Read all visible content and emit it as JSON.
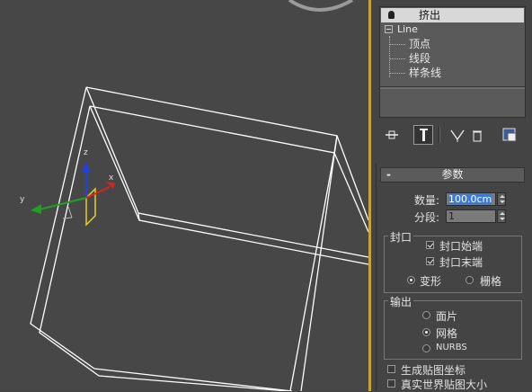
{
  "modifier_stack": {
    "items": [
      {
        "label": "挤出",
        "selected": true,
        "icon": "lightbulb-icon"
      },
      {
        "label": "Line",
        "expanded": true
      },
      {
        "label": "顶点"
      },
      {
        "label": "线段"
      },
      {
        "label": "样条线"
      }
    ]
  },
  "toolbar": {
    "pin_icon": "pin-stack-icon",
    "show_end_result_icon": "show-end-result-icon",
    "make_unique_icon": "make-unique-icon",
    "remove_modifier_icon": "remove-modifier-icon",
    "configure_icon": "configure-modifier-sets-icon"
  },
  "parameters": {
    "title": "参数",
    "collapse_symbol": "-",
    "amount": {
      "label": "数量:",
      "value": "100.0cm"
    },
    "segments": {
      "label": "分段:",
      "value": "1"
    },
    "capping": {
      "title": "封口",
      "cap_start": {
        "label": "封口始端",
        "checked": true
      },
      "cap_end": {
        "label": "封口末端",
        "checked": true
      },
      "morph": {
        "label": "变形",
        "selected": true
      },
      "grid": {
        "label": "栅格",
        "selected": false
      }
    },
    "output": {
      "title": "输出",
      "patch": {
        "label": "面片",
        "selected": false
      },
      "mesh": {
        "label": "网格",
        "selected": true
      },
      "nurbs": {
        "label": "NURBS",
        "selected": false
      }
    },
    "generate_mapping": {
      "label": "生成贴图坐标",
      "checked": false
    },
    "real_world_map_size": {
      "label": "真实世界贴图大小",
      "checked": false
    }
  },
  "viewport": {
    "axis_labels": {
      "x": "x",
      "y": "y",
      "z": "z"
    },
    "colors": {
      "x": "#e02020",
      "y": "#20a020",
      "z": "#2040e0",
      "gizmo_plane": "#e8d020",
      "wire": "#ffffff",
      "background": "#474747",
      "active_border": "#c9a23a"
    }
  }
}
